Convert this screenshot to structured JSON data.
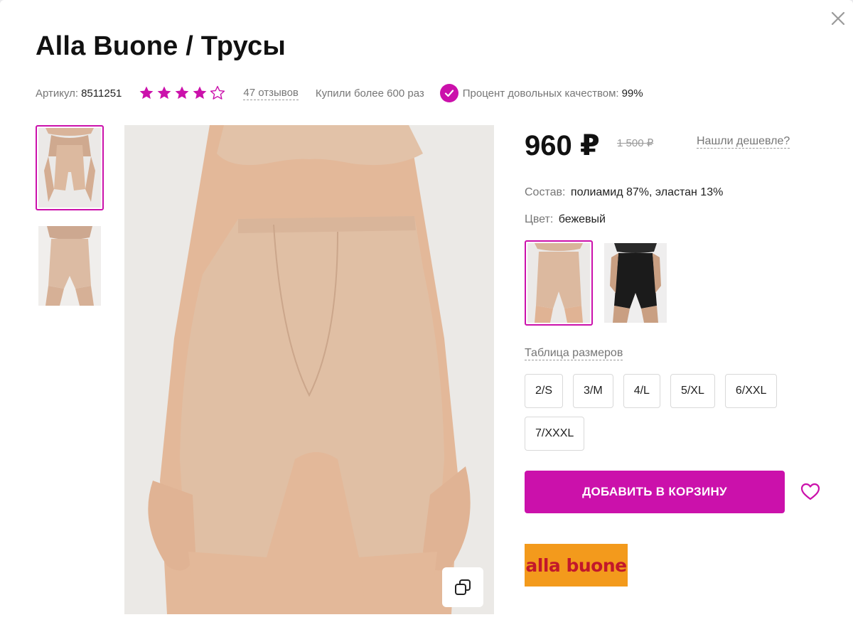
{
  "product": {
    "title": "Alla Buone / Трусы",
    "article_label": "Артикул:",
    "article_value": "8511251",
    "rating": 4,
    "rating_max": 5,
    "reviews": "47 отзывов",
    "bought": "Купили более 600 раз",
    "quality_label": "Процент довольных качеством:",
    "quality_value": "99%"
  },
  "pricing": {
    "price": "960 ₽",
    "old_price": "1 500 ₽",
    "cheaper": "Нашли дешевле?"
  },
  "props": {
    "composition_label": "Состав:",
    "composition_value": "полиамид 87%, эластан 13%",
    "color_label": "Цвет:",
    "color_value": "бежевый"
  },
  "color_options": [
    {
      "name": "бежевый",
      "swatch": "#d9b49a",
      "selected": true
    },
    {
      "name": "черный",
      "swatch": "#1b1b1b",
      "selected": false
    }
  ],
  "size_table": "Таблица размеров",
  "sizes": [
    "2/S",
    "3/M",
    "4/L",
    "5/XL",
    "6/XXL",
    "7/XXXL"
  ],
  "actions": {
    "add_to_cart": "ДОБАВИТЬ В КОРЗИНУ"
  },
  "brand": {
    "logo_text": "alla buone"
  },
  "colors": {
    "accent": "#cb11ab",
    "star": "#cb11ab",
    "logo_bg": "#f39a1c"
  },
  "icons": {
    "close": "close-icon",
    "star": "star-icon",
    "check": "check-circle-icon",
    "zoom": "zoom-icon",
    "favorite": "heart-icon"
  }
}
